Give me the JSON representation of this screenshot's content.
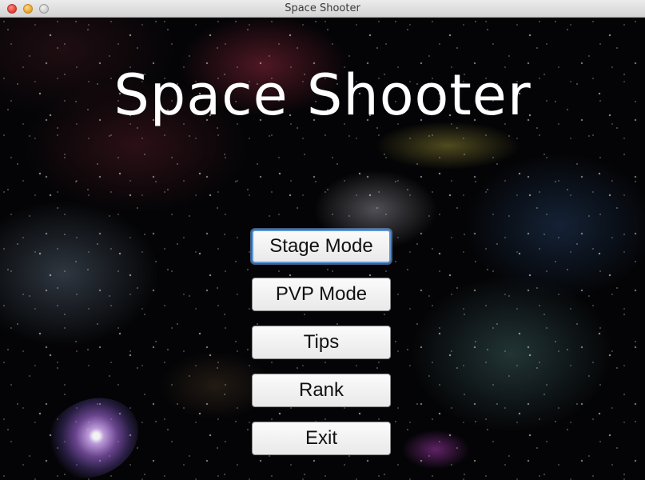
{
  "window": {
    "title": "Space Shooter",
    "controls": [
      "close",
      "minimize",
      "zoom"
    ]
  },
  "game": {
    "title": "Space Shooter",
    "menu": [
      {
        "label": "Stage Mode",
        "focused": true
      },
      {
        "label": "PVP Mode",
        "focused": false
      },
      {
        "label": "Tips",
        "focused": false
      },
      {
        "label": "Rank",
        "focused": false
      },
      {
        "label": "Exit",
        "focused": false
      }
    ]
  },
  "colors": {
    "focus_ring": "#5d95d6",
    "background": "#040406",
    "title_text": "#ffffff"
  }
}
